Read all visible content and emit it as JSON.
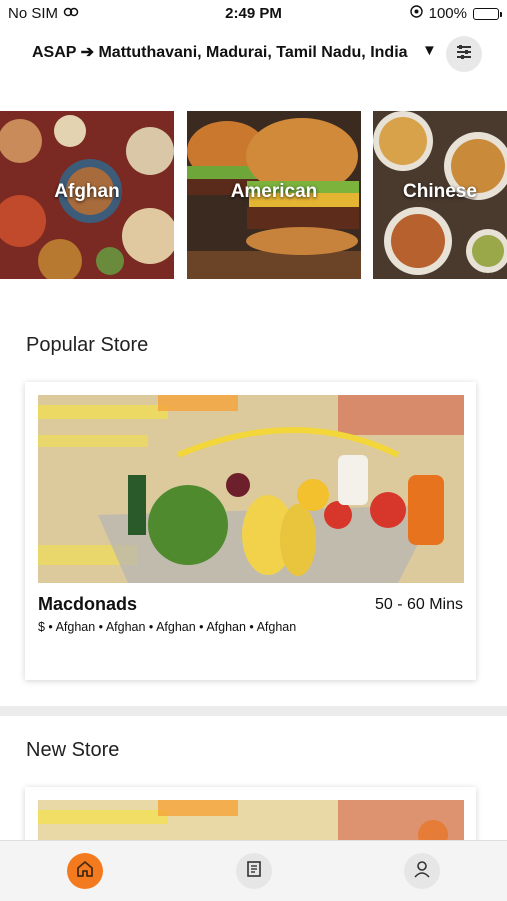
{
  "status_bar": {
    "carrier": "No SIM",
    "time": "2:49 PM",
    "battery_percent": "100%",
    "battery_level": 1.0,
    "icons": [
      "wifi-icon",
      "orientation-lock-icon",
      "battery-icon"
    ]
  },
  "location": {
    "text": "ASAP ➔ Mattuthavani, Madurai, Tamil Nadu, India",
    "caret": "▼",
    "filter_icon": "filter-sliders-icon"
  },
  "categories": [
    {
      "label": "Afghan"
    },
    {
      "label": "American"
    },
    {
      "label": "Chinese"
    }
  ],
  "popular": {
    "title": "Popular Store",
    "store": {
      "name": "Macdonads",
      "time": "50 - 60 Mins",
      "tags": "$ • Afghan • Afghan • Afghan • Afghan • Afghan"
    }
  },
  "new_store": {
    "title": "New Store"
  },
  "tabbar": {
    "items": [
      {
        "name": "home",
        "icon": "home-icon",
        "active": true
      },
      {
        "name": "orders",
        "icon": "order-list-icon",
        "active": false
      },
      {
        "name": "profile",
        "icon": "user-icon",
        "active": false
      }
    ]
  },
  "colors": {
    "accent": "#f47a1f",
    "battery": "#3cc43c"
  }
}
